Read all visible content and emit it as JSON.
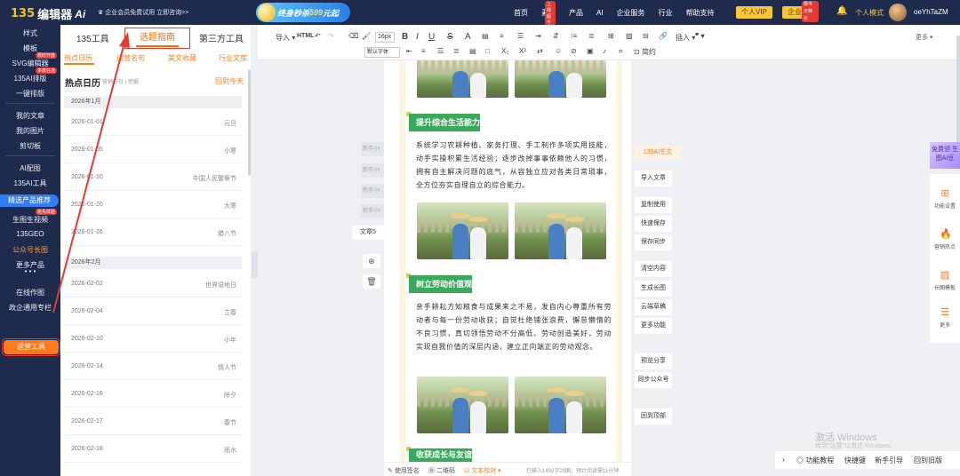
{
  "topbar": {
    "logo": {
      "mark": "135",
      "name": "编辑器",
      "ai": "Ai"
    },
    "promo": "企业会员免费试用 立即咨询>>",
    "banner": {
      "prefix": "终身秒杀",
      "price": "599",
      "suffix": "元起"
    },
    "nav": [
      "首页",
      "素材",
      "产品",
      "AI",
      "企业服务",
      "行业",
      "帮助支持"
    ],
    "nav_badge": "上线超千",
    "personal_vip": "个人VIP",
    "enterprise_vip": "企业VIP",
    "enterprise_badge": "限今天特价",
    "personal_mode": "个人模式",
    "username": "oeYhTaZM"
  },
  "sidebar": {
    "items": [
      "样式",
      "模板",
      "SVG编辑器",
      "135AI排版",
      "一键排版",
      "我的文章",
      "我的图片",
      "剪切板",
      "AI配图",
      "135AI工具",
      "精选产品推荐",
      "生图生视频",
      "135GEO",
      "公众号长图",
      "更多产品",
      "在线作图",
      "政企通用专栏",
      "运营工具"
    ],
    "badge_svg": "限时开放",
    "badge_ai": "多款任选",
    "badge_video": "抢先体验"
  },
  "panel": {
    "tabs": [
      "135工具",
      "选题指南",
      "第三方工具"
    ],
    "subtabs": [
      "热点日历",
      "运营名句",
      "美文收藏",
      "行业文库"
    ],
    "calendar_title": "热点日历",
    "calendar_sub": "营销节日 | 挖掘",
    "back_today": "回到今天",
    "months": [
      {
        "label": "2026年1月",
        "rows": [
          {
            "date": "2026-01-01",
            "holiday": "元旦"
          },
          {
            "date": "2026-01-05",
            "holiday": "小寒"
          },
          {
            "date": "2026-01-10",
            "holiday": "中国人民警察节"
          },
          {
            "date": "2026-01-20",
            "holiday": "大寒"
          },
          {
            "date": "2026-01-26",
            "holiday": "腊八节"
          }
        ]
      },
      {
        "label": "2026年2月",
        "rows": [
          {
            "date": "2026-02-02",
            "holiday": "世界湿地日"
          },
          {
            "date": "2026-02-04",
            "holiday": "立春"
          },
          {
            "date": "2026-02-10",
            "holiday": "小年"
          },
          {
            "date": "2026-02-14",
            "holiday": "情人节"
          },
          {
            "date": "2026-02-16",
            "holiday": "除夕"
          },
          {
            "date": "2026-02-17",
            "holiday": "春节"
          },
          {
            "date": "2026-02-18",
            "holiday": "雨水"
          }
        ]
      }
    ]
  },
  "toolbar": {
    "import": "导入",
    "html": "HTML",
    "font_size": "16px",
    "font_family": "默认字体",
    "insert": "插入",
    "more": "更多",
    "simple": "简约"
  },
  "editor": {
    "sections": [
      {
        "title": "提升综合生活能力",
        "text": "系统学习农耕种植、家务打理、手工制作多项实用技能，动手实操积累生活经验；逐步改掉事事依赖他人的习惯，拥有自主解决问题的底气，从容独立应对各类日常琐事，全方位夯实自理自立的综合能力。"
      },
      {
        "title": "树立劳动价值观",
        "text": "亲手耕耘方知粮食与成果来之不易，发自内心尊重所有劳动者与每一份劳动收获；自觉杜绝铺张浪费，懈怠懒惰的不良习惯，真切领悟劳动不分高低、劳动创造美好，劳动实现自我价值的深层内涵，建立正向端正的劳动观念。"
      },
      {
        "title": "收获成长与友谊",
        "text": ""
      }
    ],
    "status": {
      "signature": "使用签名",
      "qrcode": "二维码",
      "proofread": "文本校对",
      "count": "已输入1492字29图，预计阅读需11分钟"
    },
    "ghost_buttons": [
      "新手小t",
      "新手小t",
      "新手小t",
      "新手小t"
    ],
    "article_label": "文章5"
  },
  "right_actions": {
    "ai_tag": "135AI生文",
    "group1": [
      "导入文章"
    ],
    "group2": [
      "复制使用",
      "快速保存",
      "保存同步"
    ],
    "group3": [
      "清空内容",
      "生成长图",
      "云端草稿",
      "更多功能"
    ],
    "group4": [
      "预览分享",
      "同步公众号"
    ],
    "group5": [
      "回到顶部"
    ]
  },
  "rail": {
    "ai_beans": "免费领 生图AI豆",
    "items": [
      "功能设置",
      "营销热点",
      "长图模板",
      "更多"
    ]
  },
  "bottom_bar": {
    "items": [
      "功能教程",
      "快捷键",
      "新手引导",
      "回到旧版"
    ]
  },
  "watermark": {
    "line1": "激活 Windows",
    "line2": "转到\"设置\"以激活 Windows。"
  },
  "colors": {
    "brand_dark": "#1f2b4d",
    "accent_orange": "#ff7a1a",
    "section_green": "#3aa95b",
    "annotation_red": "#e53935"
  }
}
